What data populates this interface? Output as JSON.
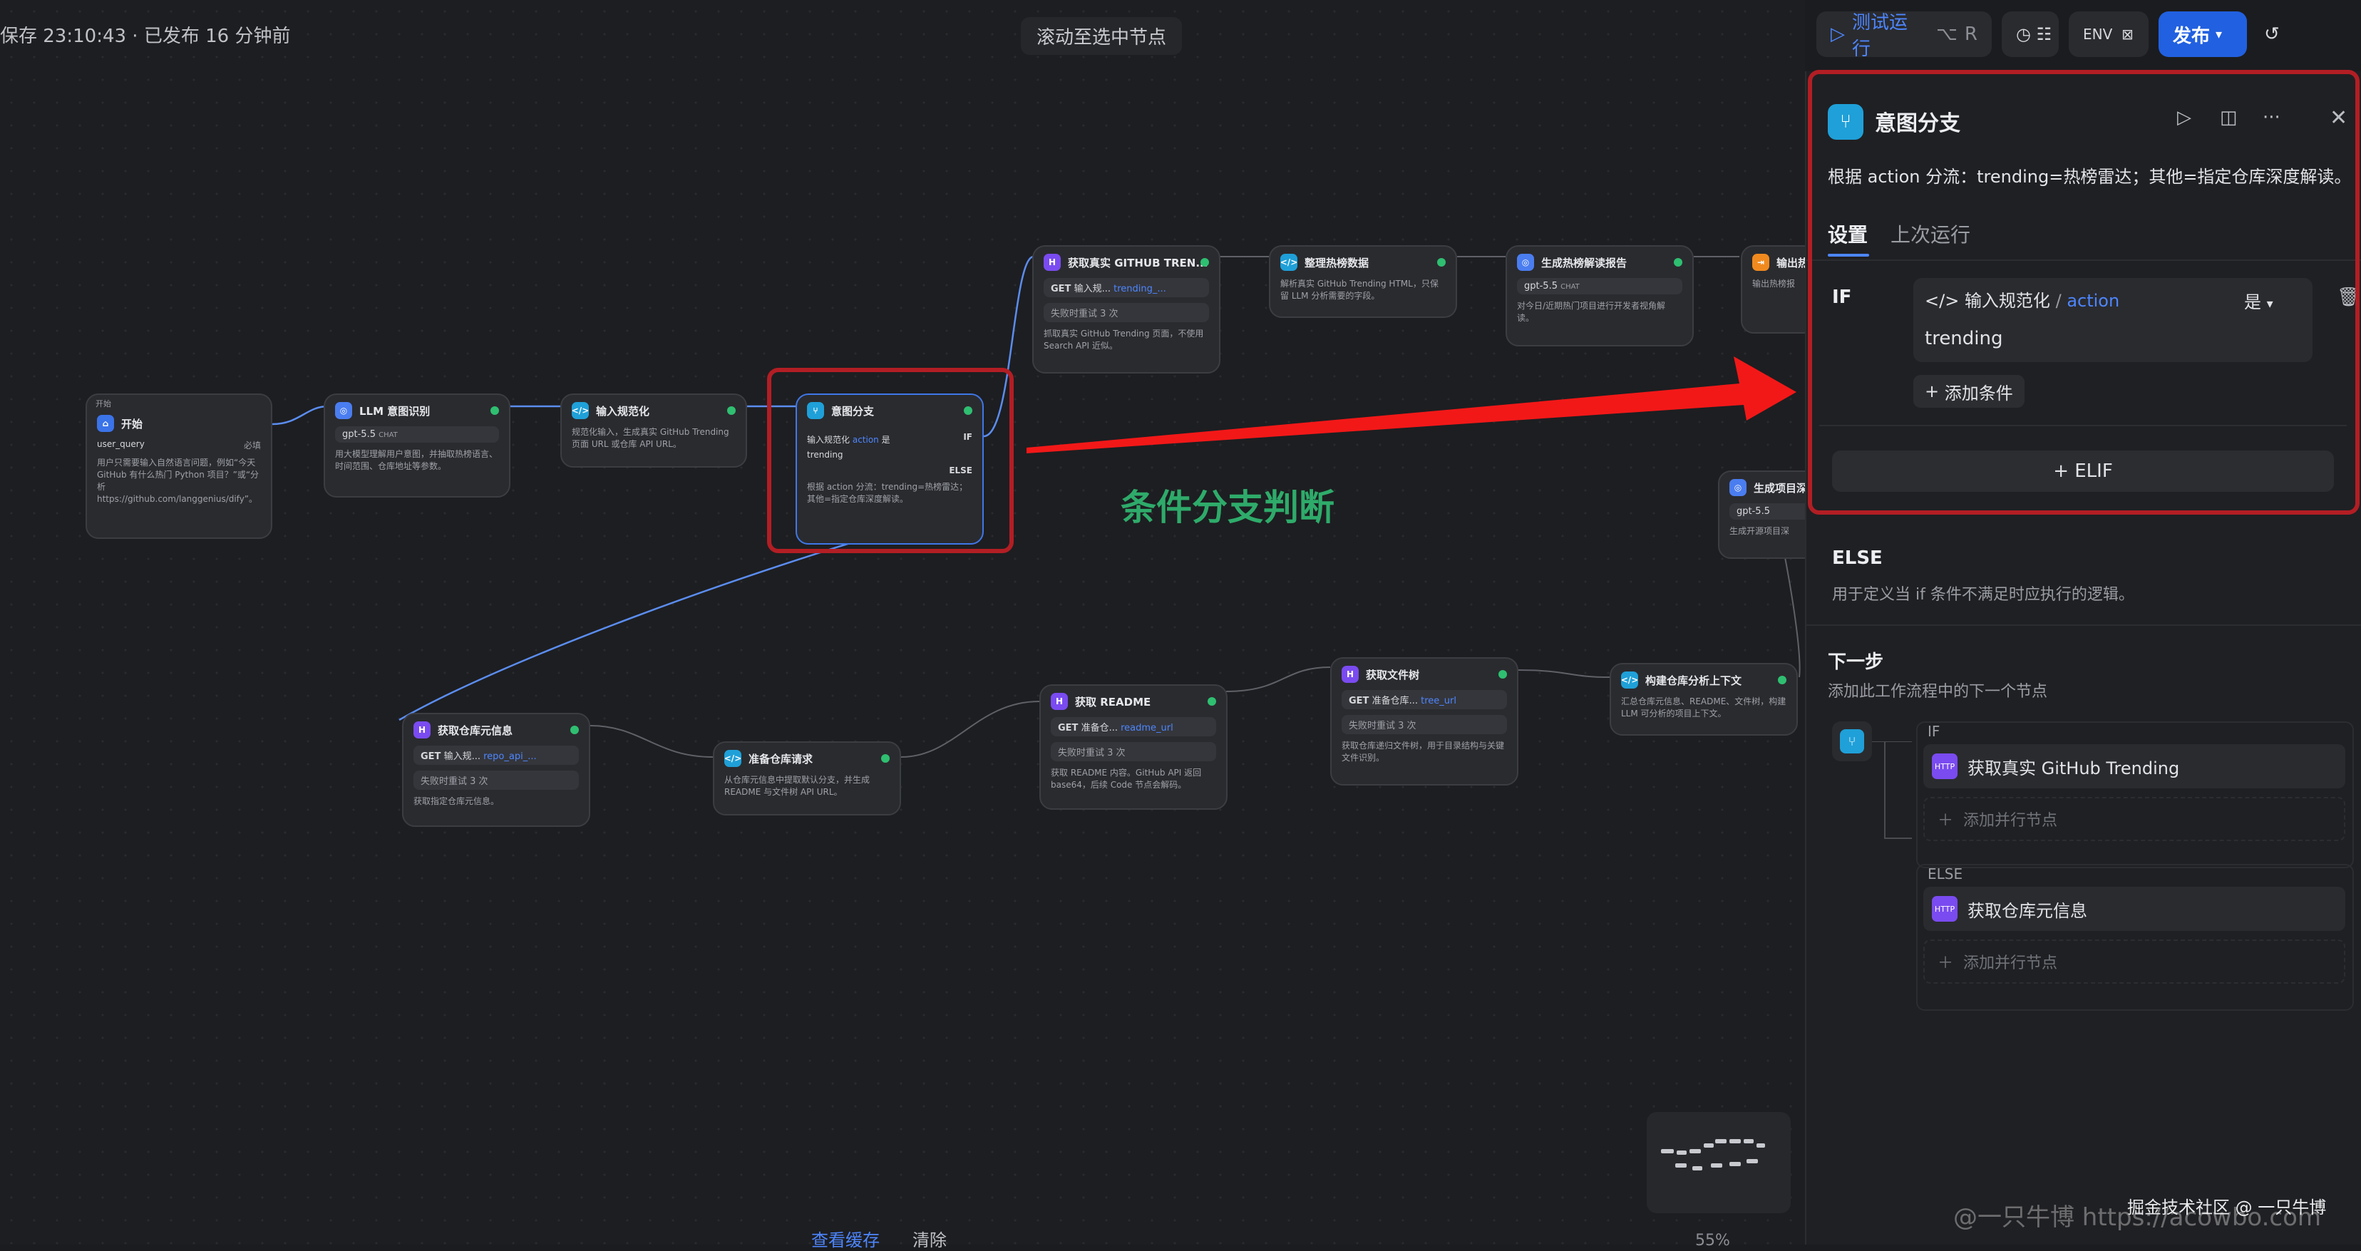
{
  "status": {
    "saved": "保存 23:10:43 · 已发布 16 分钟前"
  },
  "canvas": {
    "scroll_to_selected": "滚动至选中节点",
    "annotation": "条件分支判断",
    "bottom_left_label": "查看缓存",
    "bottom_left_label2": "清除",
    "zoom": "55%"
  },
  "nodes": {
    "start": {
      "group": "开始",
      "title": "开始",
      "var": "user_query",
      "req": "必填",
      "desc": "用户只需要输入自然语言问题，例如“今天 GitHub 有什么热门 Python 项目？”或“分析 https://github.com/langgenius/dify”。"
    },
    "llm": {
      "title": "LLM 意图识别",
      "model": "gpt-5.5",
      "mode": "CHAT",
      "desc": "用大模型理解用户意图，并抽取热榜语言、时间范围、仓库地址等参数。"
    },
    "normalize": {
      "title": "输入规范化",
      "desc": "规范化输入，生成真实 GitHub Trending 页面 URL 或仓库 API URL。"
    },
    "branch": {
      "title": "意图分支",
      "cond_src": "输入规范化",
      "cond_var": "action",
      "cond_op": "是",
      "cond_val": "trending",
      "if": "IF",
      "else": "ELSE",
      "desc": "根据 action 分流：trending=热榜雷达；其他=指定仓库深度解读。"
    },
    "fetch_trending": {
      "title": "获取真实 GITHUB TREN...",
      "method": "GET",
      "src": "输入规...",
      "var": "trending_...",
      "retry": "失败时重试 3 次",
      "desc": "抓取真实 GitHub Trending 页面，不使用 Search API 近似。"
    },
    "parse_trending": {
      "title": "整理热榜数据",
      "desc": "解析真实 GitHub Trending HTML，只保留 LLM 分析需要的字段。"
    },
    "report": {
      "title": "生成热榜解读报告",
      "model": "gpt-5.5",
      "mode": "CHAT",
      "desc": "对今日/近期热门项目进行开发者视角解读。"
    },
    "output": {
      "title": "输出热",
      "desc": "输出热榜报"
    },
    "gen_project": {
      "title": "生成项目深",
      "model": "gpt-5.5",
      "desc": "生成开源项目深"
    },
    "repo_meta": {
      "title": "获取仓库元信息",
      "method": "GET",
      "src": "输入规...",
      "var": "repo_api_...",
      "retry": "失败时重试 3 次",
      "desc": "获取指定仓库元信息。"
    },
    "prep_repo": {
      "title": "准备仓库请求",
      "desc": "从仓库元信息中提取默认分支，并生成 README 与文件树 API URL。"
    },
    "readme": {
      "title": "获取 README",
      "method": "GET",
      "src": "准备仓...",
      "var": "readme_url",
      "retry": "失败时重试 3 次",
      "desc": "获取 README 内容。GitHub API 返回 base64，后续 Code 节点会解码。"
    },
    "tree": {
      "title": "获取文件树",
      "method": "GET",
      "src": "准备仓库...",
      "var": "tree_url",
      "retry": "失败时重试 3 次",
      "desc": "获取仓库递归文件树，用于目录结构与关键文件识别。"
    },
    "context": {
      "title": "构建仓库分析上下文",
      "desc": "汇总仓库元信息、README、文件树，构建 LLM 可分析的项目上下文。"
    }
  },
  "toolbar": {
    "test_run": "测试运行",
    "shortcut1": "⌥",
    "shortcut2": "R",
    "env": "ENV",
    "publish": "发布"
  },
  "panel": {
    "title": "意图分支",
    "description": "根据 action 分流：trending=热榜雷达；其他=指定仓库深度解读。",
    "tabs": [
      "设置",
      "上次运行"
    ],
    "if_label": "IF",
    "cond_src": "输入规范化",
    "cond_var": "action",
    "cond_op": "是",
    "cond_value": "trending",
    "add_condition": "添加条件",
    "elif": "ELIF",
    "else_title": "ELSE",
    "else_desc": "用于定义当 if 条件不满足时应执行的逻辑。",
    "next_title": "下一步",
    "next_desc": "添加此工作流程中的下一个节点",
    "next_if": "IF",
    "next_if_node": "获取真实 GitHub Trending",
    "add_parallel": "添加并行节点",
    "next_else": "ELSE",
    "next_else_node": "获取仓库元信息",
    "add_parallel2": "添加并行节点"
  },
  "watermark": "掘金技术社区 @ 一只牛博",
  "watermark2": "@一只牛博 https://acowbo.com"
}
